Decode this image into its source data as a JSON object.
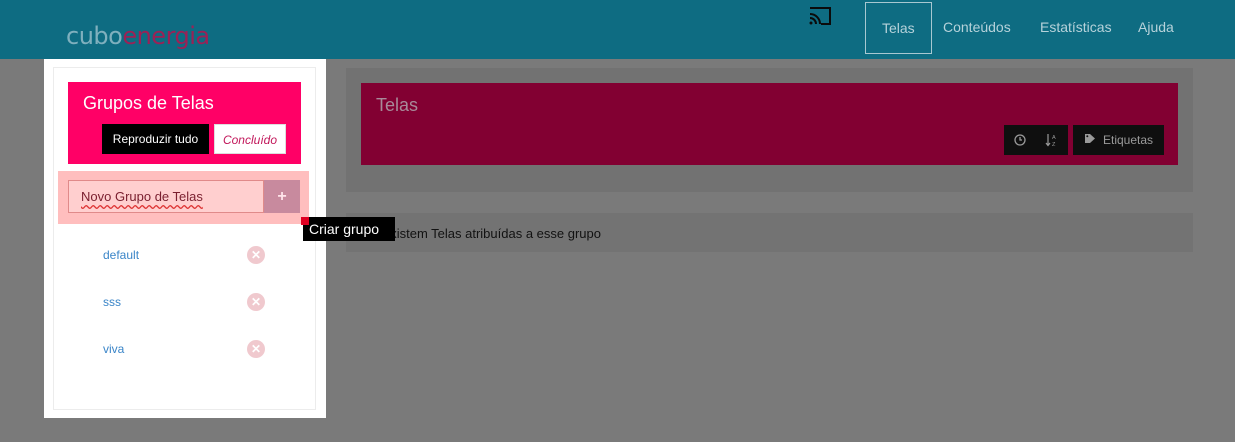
{
  "header": {
    "logo_part1": "cubo",
    "logo_part2": "energia",
    "nav": [
      {
        "label": "Telas",
        "active": true
      },
      {
        "label": "Conteúdos"
      },
      {
        "label": "Estatísticas"
      },
      {
        "label": "Ajuda"
      }
    ]
  },
  "main": {
    "title": "Telas",
    "tags_label": "Etiquetas",
    "empty_message": "existem Telas atribuídas a esse grupo"
  },
  "sidebar": {
    "title": "Grupos de Telas",
    "play_all_label": "Reproduzir tudo",
    "done_label": "Concluído",
    "new_group_value": "Novo Grupo de Telas",
    "add_label": "+",
    "tooltip": "Criar grupo",
    "groups": [
      {
        "name": "default"
      },
      {
        "name": "sss"
      },
      {
        "name": "viva"
      }
    ]
  },
  "colors": {
    "topbar": "#0e6c82",
    "accent": "#ff0066",
    "dim_accent": "#820032"
  }
}
